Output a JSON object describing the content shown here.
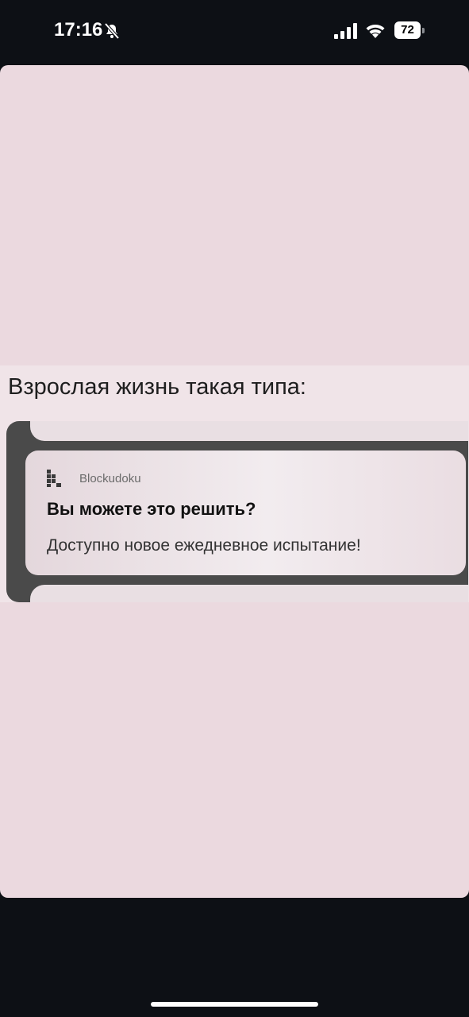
{
  "status_bar": {
    "time": "17:16",
    "battery_level": "72",
    "icons": [
      "mute-icon",
      "signal-icon",
      "wifi-icon",
      "battery-icon"
    ]
  },
  "meme": {
    "caption": "Взрослая жизнь такая типа:",
    "notification": {
      "app_name": "Blockudoku",
      "title": "Вы можете это решить?",
      "body": "Доступно новое ежедневное испытание!"
    }
  },
  "colors": {
    "background": "#0d1015",
    "card": "#ebd9df",
    "frame": "#4a4a4a"
  }
}
